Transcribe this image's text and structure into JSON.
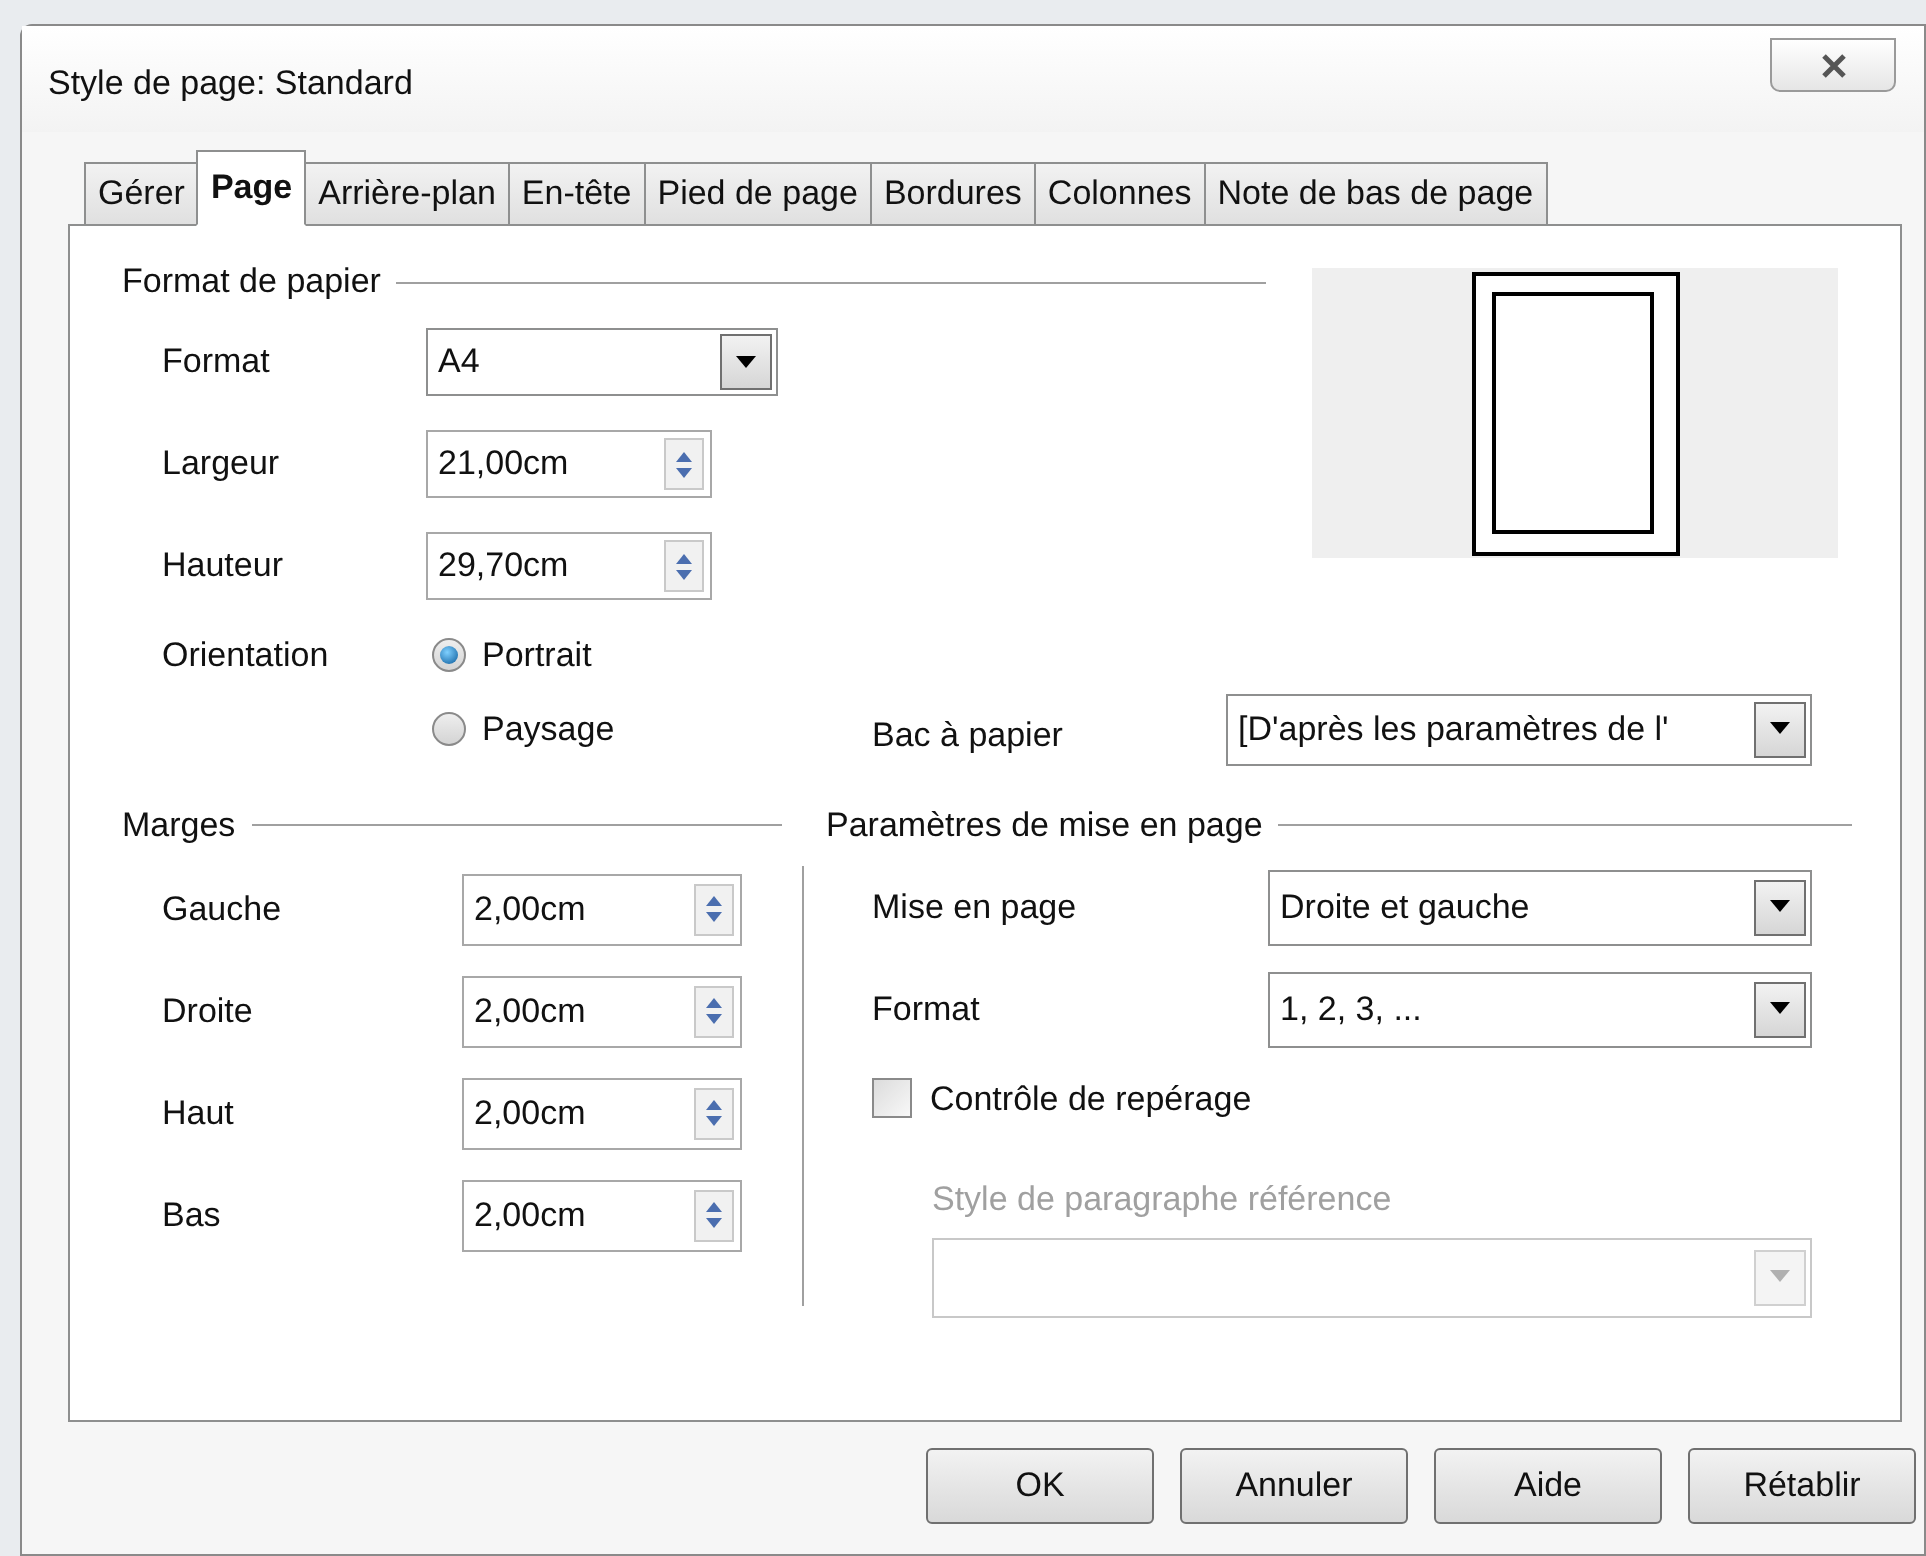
{
  "window": {
    "title": "Style de page: Standard"
  },
  "tabs": [
    {
      "label": "Gérer",
      "selected": false
    },
    {
      "label": "Page",
      "selected": true
    },
    {
      "label": "Arrière-plan",
      "selected": false
    },
    {
      "label": "En-tête",
      "selected": false
    },
    {
      "label": "Pied de page",
      "selected": false
    },
    {
      "label": "Bordures",
      "selected": false
    },
    {
      "label": "Colonnes",
      "selected": false
    },
    {
      "label": "Note de bas de page",
      "selected": false
    }
  ],
  "paper_format": {
    "heading": "Format de papier",
    "format": {
      "label": "Format",
      "value": "A4"
    },
    "width": {
      "label": "Largeur",
      "value": "21,00cm"
    },
    "height": {
      "label": "Hauteur",
      "value": "29,70cm"
    },
    "orientation": {
      "label": "Orientation",
      "options": [
        {
          "label": "Portrait",
          "selected": true
        },
        {
          "label": "Paysage",
          "selected": false
        }
      ]
    },
    "paper_tray": {
      "label": "Bac à papier",
      "value": "[D'après les paramètres de l'"
    }
  },
  "margins": {
    "heading": "Marges",
    "fields": [
      {
        "label": "Gauche",
        "value": "2,00cm"
      },
      {
        "label": "Droite",
        "value": "2,00cm"
      },
      {
        "label": "Haut",
        "value": "2,00cm"
      },
      {
        "label": "Bas",
        "value": "2,00cm"
      }
    ]
  },
  "layout_settings": {
    "heading": "Paramètres de mise en page",
    "page_layout": {
      "label": "Mise en page",
      "value": "Droite et gauche"
    },
    "format": {
      "label": "Format",
      "value": "1, 2, 3, ..."
    },
    "register_true": {
      "label": "Contrôle de repérage",
      "checked": false
    },
    "reference_style": {
      "label": "Style de paragraphe référence",
      "disabled": true
    }
  },
  "buttons": [
    {
      "label": "OK"
    },
    {
      "label": "Annuler"
    },
    {
      "label": "Aide"
    },
    {
      "label": "Rétablir"
    }
  ]
}
